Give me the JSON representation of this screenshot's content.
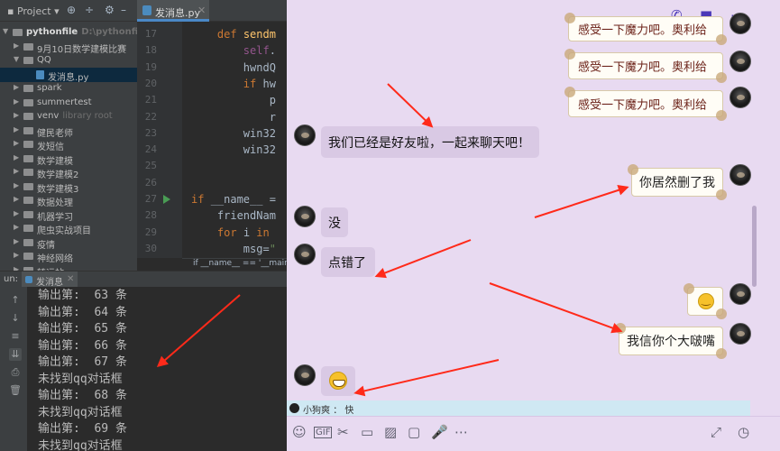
{
  "ide": {
    "project_header": "Project",
    "file_tab": "发消息.py",
    "tree": [
      {
        "label": "pythonfile",
        "extra": "D:\\pythonfile",
        "level": 0,
        "open": true,
        "bold": true
      },
      {
        "label": "9月10日数学建模比赛",
        "extra": "",
        "level": 1,
        "open": false
      },
      {
        "label": "QQ",
        "extra": "",
        "level": 1,
        "open": true
      },
      {
        "label": "发消息.py",
        "extra": "",
        "level": 2,
        "file": true,
        "selected": true
      },
      {
        "label": "spark",
        "extra": "",
        "level": 1,
        "open": false
      },
      {
        "label": "summertest",
        "extra": "",
        "level": 1,
        "open": false
      },
      {
        "label": "venv",
        "extra": "library root",
        "level": 1,
        "open": false
      },
      {
        "label": "健民老师",
        "extra": "",
        "level": 1,
        "open": false
      },
      {
        "label": "发短信",
        "extra": "",
        "level": 1,
        "open": false
      },
      {
        "label": "数学建模",
        "extra": "",
        "level": 1,
        "open": false
      },
      {
        "label": "数学建模2",
        "extra": "",
        "level": 1,
        "open": false
      },
      {
        "label": "数学建模3",
        "extra": "",
        "level": 1,
        "open": false
      },
      {
        "label": "数据处理",
        "extra": "",
        "level": 1,
        "open": false
      },
      {
        "label": "机器学习",
        "extra": "",
        "level": 1,
        "open": false
      },
      {
        "label": "爬虫实战项目",
        "extra": "",
        "level": 1,
        "open": false
      },
      {
        "label": "疫情",
        "extra": "",
        "level": 1,
        "open": false
      },
      {
        "label": "神经网络",
        "extra": "",
        "level": 1,
        "open": false
      },
      {
        "label": "转运站",
        "extra": "",
        "level": 1,
        "open": false
      }
    ],
    "line_numbers": [
      "17",
      "18",
      "19",
      "20",
      "21",
      "22",
      "23",
      "24",
      "25",
      "26",
      "27",
      "28",
      "29",
      "30"
    ],
    "code_lines": [
      {
        "indent": "    ",
        "parts": [
          [
            "kw",
            "def "
          ],
          [
            "fn",
            "sendm"
          ]
        ]
      },
      {
        "indent": "        ",
        "parts": [
          [
            "slf",
            "self"
          ],
          [
            "",
            "."
          ]
        ]
      },
      {
        "indent": "        ",
        "parts": [
          [
            "",
            "hwndQ"
          ]
        ]
      },
      {
        "indent": "        ",
        "parts": [
          [
            "kw",
            "if "
          ],
          [
            "",
            "hw"
          ]
        ]
      },
      {
        "indent": "            ",
        "parts": [
          [
            "",
            "p"
          ]
        ]
      },
      {
        "indent": "            ",
        "parts": [
          [
            "",
            "r"
          ]
        ]
      },
      {
        "indent": "        ",
        "parts": [
          [
            "",
            "win32"
          ]
        ]
      },
      {
        "indent": "        ",
        "parts": [
          [
            "",
            "win32"
          ]
        ]
      },
      {
        "indent": "",
        "parts": [
          [
            "",
            ""
          ]
        ]
      },
      {
        "indent": "",
        "parts": [
          [
            "",
            ""
          ]
        ]
      },
      {
        "indent": "",
        "parts": [
          [
            "kw",
            "if "
          ],
          [
            "",
            "__name__ ="
          ]
        ]
      },
      {
        "indent": "    ",
        "parts": [
          [
            "",
            "friendNam"
          ]
        ]
      },
      {
        "indent": "    ",
        "parts": [
          [
            "kw",
            "for "
          ],
          [
            "",
            "i "
          ],
          [
            "kw",
            "in"
          ]
        ]
      },
      {
        "indent": "        ",
        "parts": [
          [
            "",
            "msg="
          ],
          [
            "str",
            "\""
          ]
        ]
      }
    ],
    "breadcrumb": "if __name__ == '__main'",
    "run_label": "un:",
    "run_tab": "发消息",
    "console_lines": [
      "输出第:  63 条",
      "输出第:  64 条",
      "输出第:  65 条",
      "输出第:  66 条",
      "输出第:  67 条",
      "未找到qq对话框",
      "输出第:  68 条",
      "未找到qq对话框",
      "输出第:  69 条",
      "未找到qq对话框"
    ]
  },
  "chat": {
    "header_icons": [
      "phone-icon",
      "video-icon",
      "more-icon"
    ],
    "card_text": "感受一下魔力吧。奥利给",
    "messages": {
      "friend_1": "我们已经是好友啦，一起来聊天吧！",
      "self_1": "你居然删了我",
      "friend_2": "没",
      "friend_3": "点错了",
      "self_2": "我信你个大啵嘴"
    },
    "hint_name": "小狗爽",
    "hint_sep": "：",
    "hint_text": "快",
    "toolbar_icons": [
      "emoji-icon",
      "gif-icon",
      "scissors-icon",
      "folder-icon",
      "image-icon",
      "gift-icon",
      "mic-icon",
      "more-dots-icon",
      "expand-icon",
      "history-icon"
    ],
    "toolbar_glyphs": [
      "☺",
      "GIF",
      "✂",
      "▭",
      "▨",
      "▢",
      "🎤",
      "⋯",
      "⤢",
      "◷"
    ],
    "arrow_color": "#ff2a1a",
    "accent": "#4b39b8"
  }
}
